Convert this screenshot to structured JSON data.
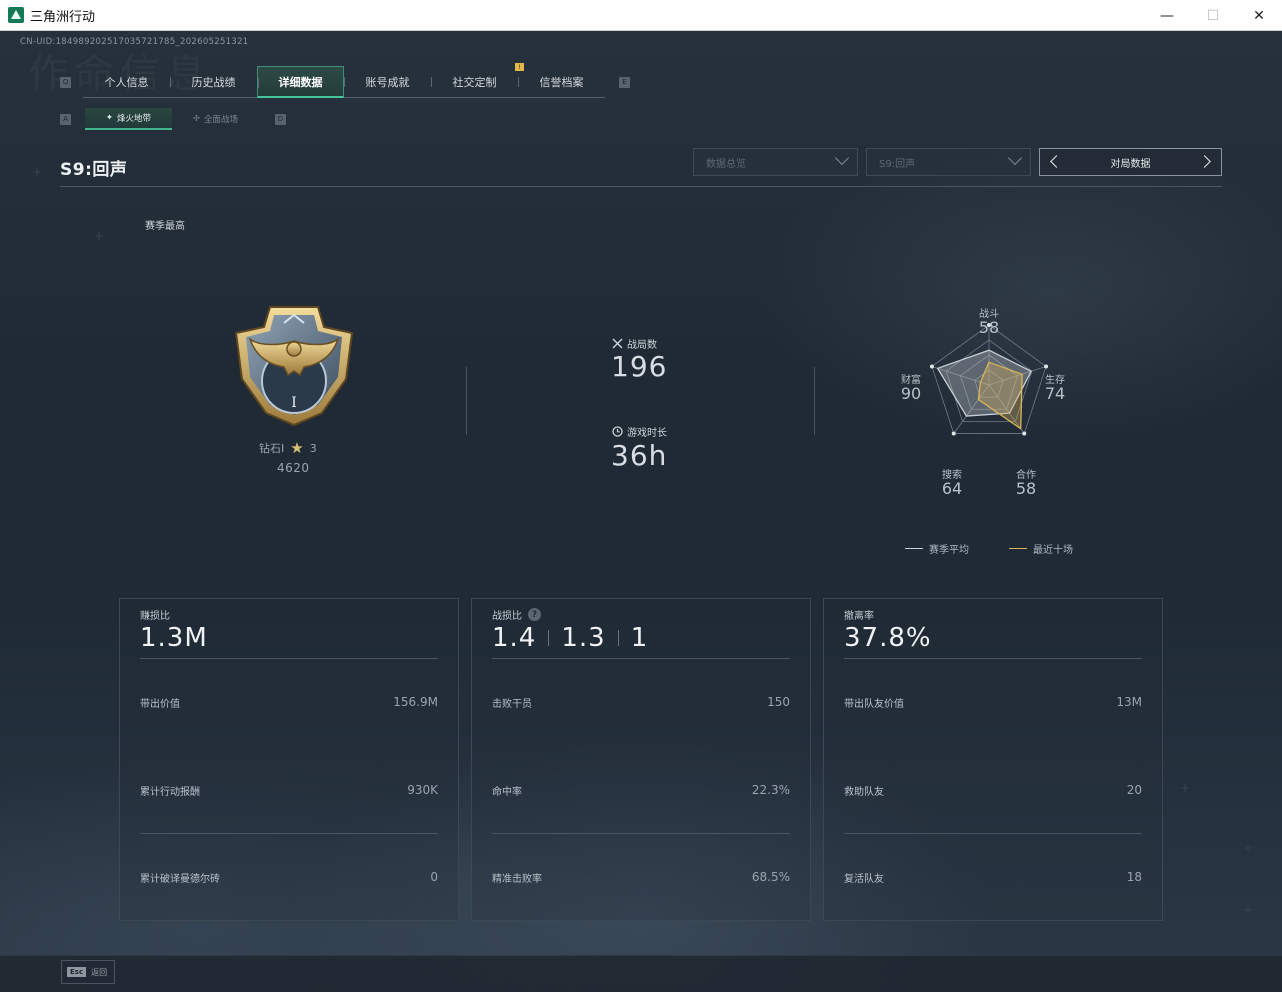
{
  "window": {
    "title": "三角洲行动",
    "minimize": "—",
    "maximize": "☐",
    "close": "✕"
  },
  "cnuid": "CN-UID:18498920251703572178​5_2026052513​21",
  "nav": {
    "left_key": "Q",
    "right_key": "E",
    "tabs": [
      "个人信息",
      "历史战绩",
      "详细数据",
      "账号成就",
      "社交定制",
      "信誉档案"
    ],
    "active_tab": 2,
    "badge_tab": 4
  },
  "subnav": {
    "left_key": "A",
    "right_key": "D",
    "tabs": [
      {
        "label": "烽火地带",
        "icon": "hazard-zone-icon"
      },
      {
        "label": "全面战场",
        "icon": "warfare-icon"
      }
    ],
    "active": 0
  },
  "season": {
    "title": "S9:回声",
    "dropdown1": "数据总览",
    "dropdown2": "S9:回声",
    "pager_label": "对局数据"
  },
  "rank": {
    "section_label": "赛季最高",
    "tier": "钻石I",
    "stars": "3",
    "points": "4620"
  },
  "stats": {
    "matches_label": "战局数",
    "matches_value": "196",
    "playtime_label": "游戏时长",
    "playtime_value": "36h"
  },
  "radar": {
    "axes": [
      {
        "label": "战斗",
        "value": "58"
      },
      {
        "label": "生存",
        "value": "74"
      },
      {
        "label": "合作",
        "value": "58"
      },
      {
        "label": "搜索",
        "value": "64"
      },
      {
        "label": "财富",
        "value": "90"
      }
    ],
    "season_avg": [
      58,
      74,
      58,
      64,
      90
    ],
    "recent_ten": [
      38,
      58,
      90,
      30,
      15
    ],
    "legend": {
      "season_avg": "赛季平均",
      "recent_ten": "最近十场"
    },
    "colors": {
      "season_avg": "#c8ced3",
      "recent_ten": "#d9b45a"
    }
  },
  "cards": [
    {
      "head_label": "赚损比",
      "head_value": "1.3M",
      "rows": [
        {
          "label": "带出价值",
          "value": "156.9M"
        },
        {
          "label": "累计行动报酬",
          "value": "930K"
        },
        {
          "label": "累计破译曼德尔砖",
          "value": "0"
        }
      ]
    },
    {
      "head_label": "战损比",
      "head_values": [
        "1.4",
        "1.3",
        "1"
      ],
      "rows": [
        {
          "label": "击败干员",
          "value": "150"
        },
        {
          "label": "命中率",
          "value": "22.3%"
        },
        {
          "label": "精准击败率",
          "value": "68.5%"
        }
      ]
    },
    {
      "head_label": "撤离率",
      "head_value": "37.8%",
      "rows": [
        {
          "label": "带出队友价值",
          "value": "13M"
        },
        {
          "label": "救助队友",
          "value": "20"
        },
        {
          "label": "复活队友",
          "value": "18"
        }
      ]
    }
  ],
  "footer": {
    "esc_key": "Esc",
    "esc_label": "返回"
  },
  "colors": {
    "accent": "#46c49a",
    "badge": "#e0b64a"
  }
}
